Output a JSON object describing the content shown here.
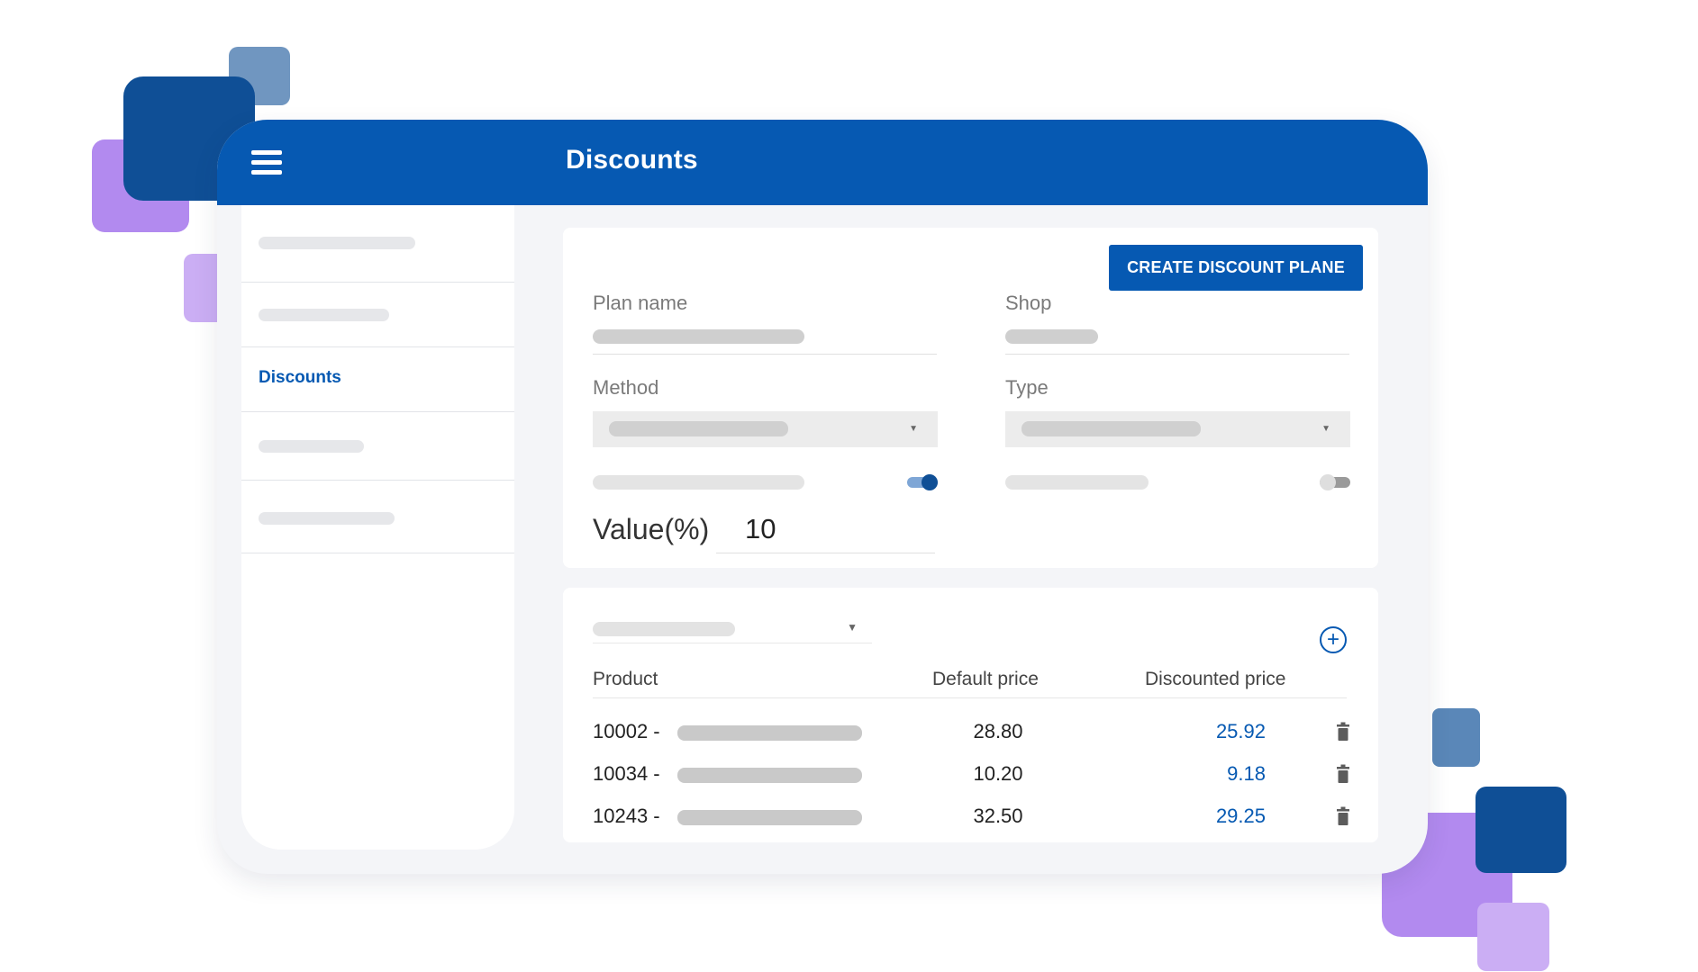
{
  "header": {
    "title": "Discounts",
    "menu_icon": "hamburger-menu-icon"
  },
  "sidebar": {
    "items": [
      {
        "label": "",
        "placeholder": true
      },
      {
        "label": "",
        "placeholder": true
      },
      {
        "label": "Discounts",
        "active": true
      },
      {
        "label": "",
        "placeholder": true
      },
      {
        "label": "",
        "placeholder": true
      }
    ]
  },
  "form": {
    "create_button": "CREATE DISCOUNT PLANE",
    "plan_name_label": "Plan name",
    "shop_label": "Shop",
    "method_label": "Method",
    "type_label": "Type",
    "toggle1_on": true,
    "toggle2_on": false,
    "value_label": "Value(%)",
    "value": "10"
  },
  "products": {
    "add_icon": "plus-circle-icon",
    "columns": [
      "Product",
      "Default price",
      "Discounted price"
    ],
    "rows": [
      {
        "code": "10002 -",
        "default_price": "28.80",
        "discounted_price": "25.92"
      },
      {
        "code": "10034 -",
        "default_price": "10.20",
        "discounted_price": "9.18"
      },
      {
        "code": "10243 -",
        "default_price": "32.50",
        "discounted_price": "29.25"
      }
    ],
    "delete_icon": "trash-icon"
  },
  "colors": {
    "primary": "#0659b2",
    "deco_dark_blue": "#0f4f96",
    "deco_steel_blue": "#5a87b8",
    "deco_purple": "#b28aef",
    "deco_light_purple": "#cbaef4"
  }
}
